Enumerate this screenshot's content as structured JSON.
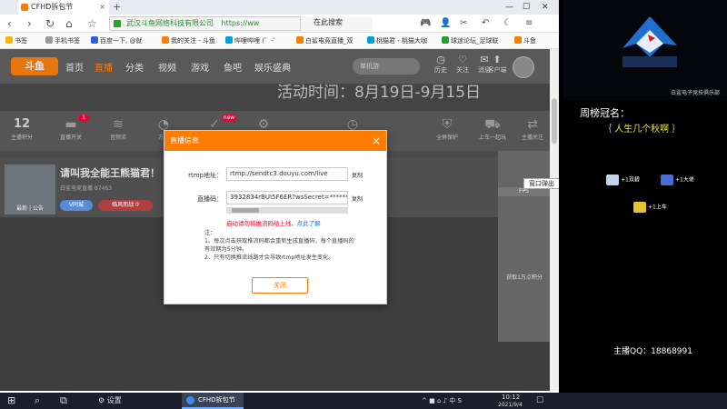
{
  "browser": {
    "tab_title": "CFHD拆包节",
    "tab_close": "×",
    "new_tab": "+",
    "window_controls": [
      "—",
      "☐",
      "✕"
    ],
    "nav": {
      "back": "‹",
      "forward": "›",
      "reload": "↻",
      "home": "⌂",
      "bookmark_icon": "☆"
    },
    "url_site": "武汉斗鱼网络科技有限公司",
    "url": "https://ww",
    "search_placeholder": "在此搜索",
    "toolbar_icons": [
      "🎮",
      "👤",
      "✂",
      "↶",
      "☾",
      "≡"
    ],
    "bookmarks": [
      "书签",
      "手机书签",
      "百度一下, @就",
      "我的关注 - 斗鱼",
      "哔哩哔哩 (゜-゜",
      "白鲨电竞直播_双",
      "桃猫君 - 桃猫大咖",
      "球迷论坛_足球联",
      "斗鱼"
    ]
  },
  "douyu": {
    "logo": "斗鱼",
    "nav": [
      "首页",
      "直播",
      "分类",
      "视频",
      "游戏",
      "鱼吧",
      "娱乐盛典"
    ],
    "search_placeholder": "单机游",
    "header_icons": [
      {
        "glyph": "◷",
        "label": "历史"
      },
      {
        "glyph": "♡",
        "label": "关注"
      },
      {
        "glyph": "✉",
        "label": "消息"
      },
      {
        "glyph": "⬆",
        "label": "客户端"
      }
    ],
    "banner": "活动时间：8月19日-9月15日",
    "tools": [
      {
        "value": "12",
        "label": "主播积分"
      },
      {
        "glyph": "▬",
        "label": "直播开关",
        "badge": "1"
      },
      {
        "glyph": "≋",
        "label": "音频流"
      },
      {
        "glyph": "◔",
        "label": "方式"
      },
      {
        "glyph": "✓",
        "label": "签到",
        "badge": "new"
      },
      {
        "glyph": "⚙",
        "label": "设置"
      },
      {
        "glyph": "◷",
        "label": "时长"
      },
      {
        "glyph": "⛨",
        "label": "全屏保护"
      },
      {
        "glyph": "⛟",
        "label": "上车一起玩"
      },
      {
        "glyph": "⇄",
        "label": "主播关注"
      }
    ],
    "room": {
      "title": "请叫我全能王熊猫君！",
      "thumb_caption": "最新 | 公告",
      "meta": "白鲨电竞直播  87463",
      "btn1": "V同城",
      "btn2": "临风而战 0"
    },
    "side": {
      "fps": "FPS",
      "float_window": "窗口弹出",
      "promo": "获取1万点积分"
    }
  },
  "modal": {
    "title": "直播信息",
    "close": "×",
    "rtmp_label": "rtmp地址：",
    "rtmp_value": "rtmp://sendtc3.douyu.com/live",
    "code_label": "直播码：",
    "code_value": "3932834rBUI5F6ER?wsSecret=**********",
    "copy": "复制",
    "warning": "启动请勿将推流码给上线,",
    "warning_link": "点此了解",
    "notes_title": "注：",
    "note1": "1、每次点击获取推流码都会重新生成直播码，每个直播码的有效期为5分钟。",
    "note2": "2、只有切换推流线路才会导致rtmp地址发生变化。",
    "button": "关闭"
  },
  "overlay": {
    "logo_sub": "白鲨电子竞技俱乐部",
    "weekly_title": "周榜冠名：",
    "fan_name": "｛ 人生几个秋啊 ｝",
    "gifts": [
      "+1双碧",
      "+1大佬",
      "+1上车"
    ],
    "qq": "主播QQ：18868991"
  },
  "taskbar": {
    "start": "⊞",
    "search": "⌕",
    "taskview": "⧉",
    "settings_icon": "⚙",
    "settings": "设置",
    "app": "CFHD拆包节",
    "tray": "^  ■  ⌂  ♪  中  S",
    "time": "10:12",
    "date": "2021/9/4",
    "notify": "☐"
  },
  "colors": {
    "accent": "#ff7c00",
    "link": "#1a6ed8",
    "warn": "#e02",
    "qq": "#ffffff",
    "fan": "#f0e040"
  }
}
